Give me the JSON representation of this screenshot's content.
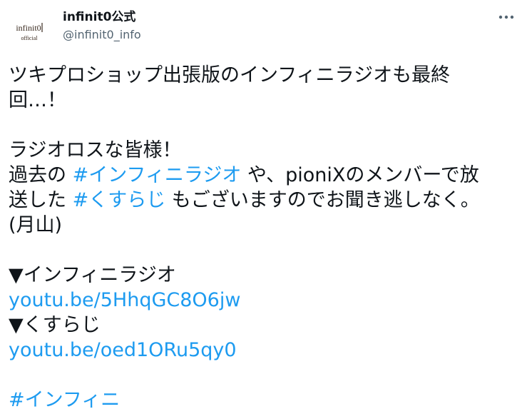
{
  "tweet_header": {
    "display_name": "infinit0公式",
    "handle": "@infinit0_info",
    "avatar_logo_text": "infinit0",
    "avatar_sub_text": "official",
    "more_icon": "more-horizontal-icon"
  },
  "tweet_body": {
    "line1": "ツキプロショップ出張版のインフィニラジオも最終",
    "line2": "回…！",
    "line3": "ラジオロスな皆様！",
    "line4_prefix": "過去の ",
    "hashtag1": "#インフィニラジオ",
    "line4_suffix": " や、pioniXのメンバーで放",
    "line5_prefix": "送した ",
    "hashtag2": "#くすらじ",
    "line5_suffix": " もございますのでお聞き逃しなく。",
    "line6": "(月山)",
    "section1_label": "▼インフィニラジオ",
    "link1": "youtu.be/5HhqGC8O6jw",
    "section2_label": "▼くすらじ",
    "link2": "youtu.be/oed1ORu5qy0",
    "hashtag3": "#インフィニ"
  },
  "colors": {
    "text": "#0f1419",
    "secondary": "#536471",
    "link": "#1d9bf0"
  }
}
